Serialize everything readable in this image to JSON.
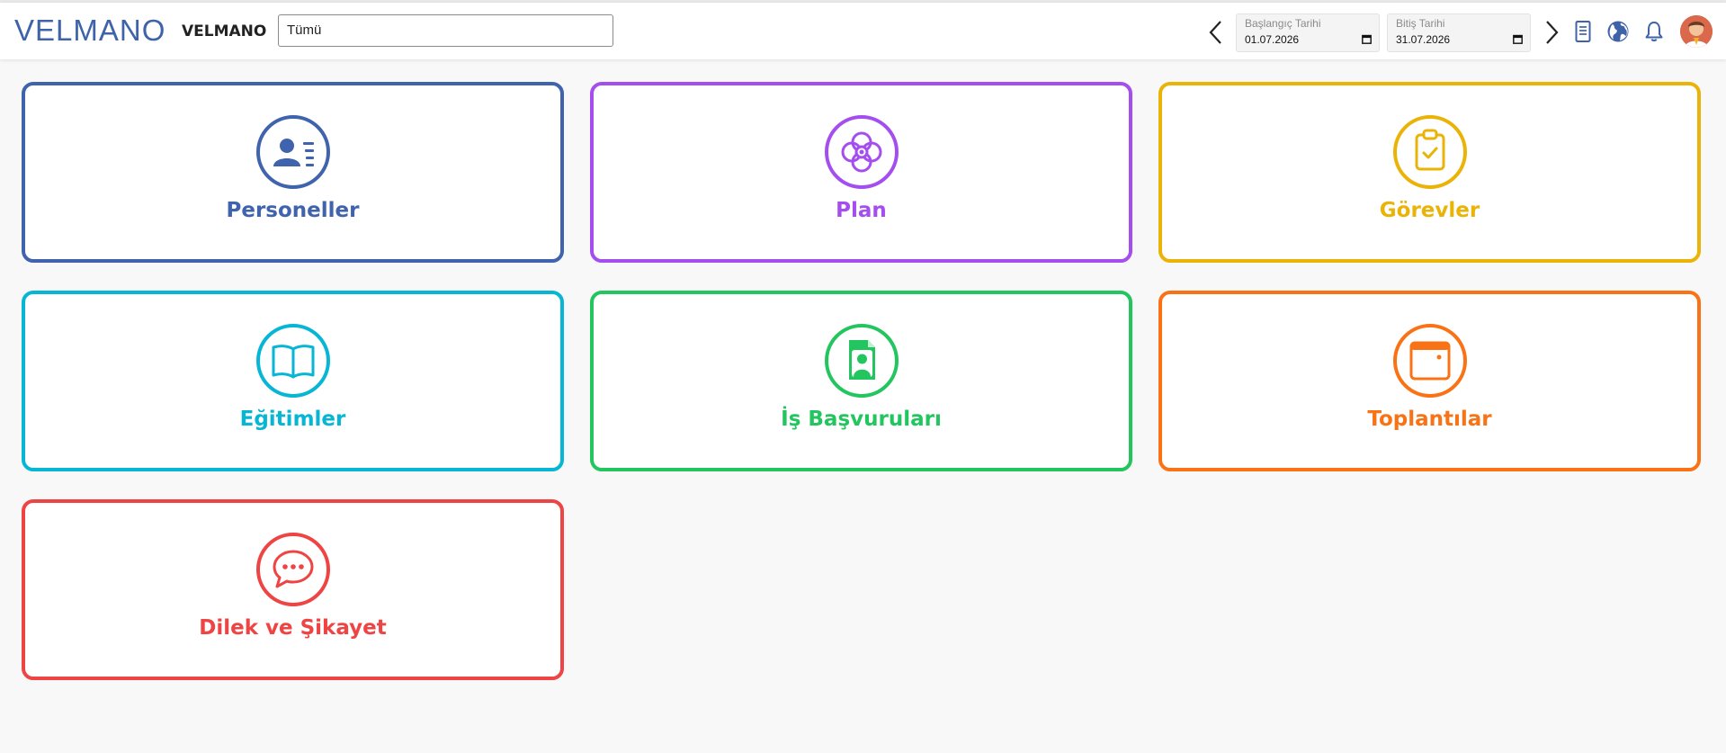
{
  "header": {
    "logo": "VELMANO",
    "brand_name": "VELMANO",
    "filter_select": {
      "value": "Tümü"
    },
    "start_date": {
      "label": "Başlangıç Tarihi",
      "value": "01.07.2026"
    },
    "end_date": {
      "label": "Bitiş Tarihi",
      "value": "31.07.2026"
    },
    "icons": [
      "chevron-left-icon",
      "chevron-right-icon",
      "document-icon",
      "globe-icon",
      "bell-icon",
      "user-avatar"
    ]
  },
  "cards": [
    {
      "label": "Personeller",
      "color": "#3f63ac",
      "icon": "contact-card-icon"
    },
    {
      "label": "Plan",
      "color": "#a44ef0",
      "icon": "flower-icon"
    },
    {
      "label": "Görevler",
      "color": "#eab308",
      "icon": "clipboard-check-icon"
    },
    {
      "label": "Eğitimler",
      "color": "#06b6d4",
      "icon": "open-book-icon"
    },
    {
      "label": "İş Başvuruları",
      "color": "#22c55e",
      "icon": "user-document-icon"
    },
    {
      "label": "Toplantılar",
      "color": "#f97316",
      "icon": "window-calendar-icon"
    },
    {
      "label": "Dilek ve Şikayet",
      "color": "#ef4444",
      "icon": "chat-bubble-icon"
    }
  ]
}
